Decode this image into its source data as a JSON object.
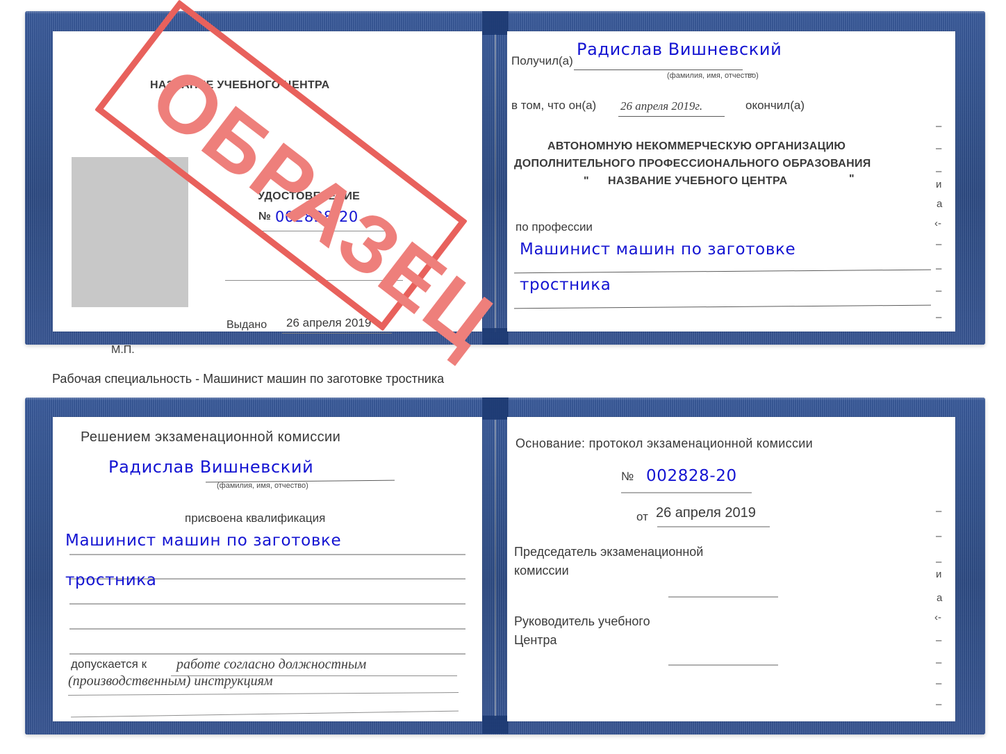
{
  "caption": "Рабочая специальность - Машинист машин по заготовке тростника",
  "colors": {
    "cover_navy": "#24488c",
    "stamp_red": "#e8615c",
    "stamp_text_red": "#ee7f7b",
    "ink_blue": "#1414d2",
    "photo_grey": "#c8c8c8",
    "page_white": "#ffffff"
  },
  "stamp": {
    "text": "ОБРАЗЕЦ"
  },
  "certificate_top": {
    "left_page": {
      "org_header": "НАЗВАНИЕ УЧЕБНОГО ЦЕНТРА",
      "doc_type": "УДОСТОВЕРЕНИЕ",
      "number_symbol": "№",
      "number_value": "002828-20",
      "issued_label": "Выдано",
      "issued_date": "26 апреля 2019",
      "seal_label": "М.П."
    },
    "right_page": {
      "received_label": "Получил(а)",
      "received_name": "Радислав Вишневский",
      "name_hint": "(фамилия, имя, отчество)",
      "in_that_label": "в том, что он(а)",
      "completion_date": "26 апреля 2019г.",
      "finished_label": "окончил(а)",
      "org_line1": "АВТОНОМНУЮ НЕКОММЕРЧЕСКУЮ ОРГАНИЗАЦИЮ",
      "org_line2": "ДОПОЛНИТЕЛЬНОГО ПРОФЕССИОНАЛЬНОГО ОБРАЗОВАНИЯ",
      "org_quote_open": "\"",
      "org_line3": "НАЗВАНИЕ УЧЕБНОГО ЦЕНТРА",
      "org_quote_close": "\"",
      "profession_label": "по профессии",
      "profession_line1": "Машинист машин по заготовке",
      "profession_line2": "тростника",
      "edge_fragments": [
        "–",
        "–",
        "–",
        "и",
        "а",
        "‹-",
        "–",
        "–",
        "–",
        "–"
      ]
    }
  },
  "certificate_bottom": {
    "left_page": {
      "decision_header": "Решением экзаменационной комиссии",
      "name": "Радислав Вишневский",
      "name_hint": "(фамилия, имя, отчество)",
      "qualification_label": "присвоена квалификация",
      "qualification_line1": "Машинист машин по заготовке",
      "qualification_line2": "тростника",
      "admitted_label": "допускается к",
      "admitted_line1": "работе согласно должностным",
      "admitted_line2": "(производственным) инструкциям"
    },
    "right_page": {
      "basis_label": "Основание: протокол экзаменационной комиссии",
      "number_symbol": "№",
      "number_value": "002828-20",
      "date_label": "от",
      "date_value": "26 апреля 2019",
      "chairman_line1": "Председатель экзаменационной",
      "chairman_line2": "комиссии",
      "director_line1": "Руководитель учебного",
      "director_line2": "Центра",
      "edge_fragments": [
        "–",
        "–",
        "–",
        "и",
        "а",
        "‹-",
        "–",
        "–",
        "–",
        "–"
      ]
    }
  }
}
